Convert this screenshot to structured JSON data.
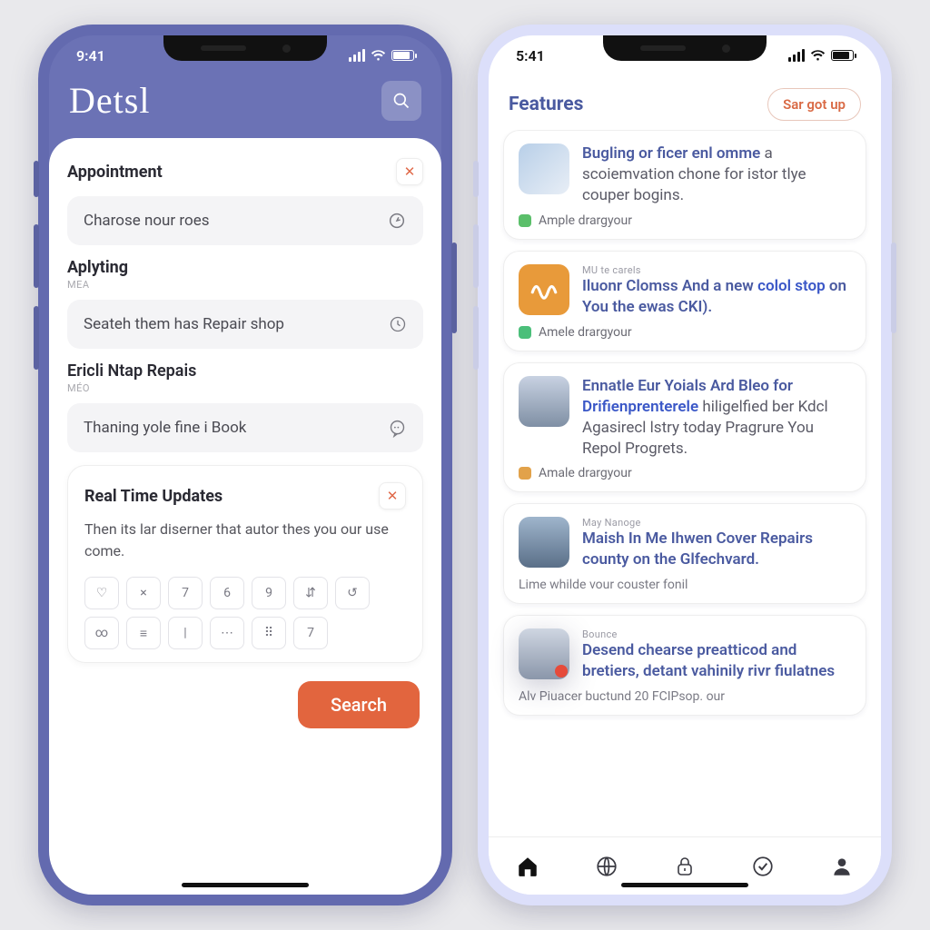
{
  "left": {
    "status_time": "9:41",
    "brand": "Detsl",
    "sections": {
      "appointment": {
        "title": "Appointment",
        "field": "Charose nour roes"
      },
      "applying": {
        "title": "Aplyting",
        "sub": "MEA",
        "field": "Seateh them has Repair shop"
      },
      "repairs": {
        "title": "Ericli Ntap Repais",
        "sub": "MÉO",
        "field": "Thaning yole fine i Book"
      },
      "realtime": {
        "title": "Real Time Updates",
        "desc": "Then its lar diserner that autor thes you our use come.",
        "keys": [
          "♡",
          "×",
          "7",
          "6",
          "9",
          "⇵",
          "↺",
          "∞",
          "≡",
          "|",
          "⋯",
          "⠿",
          "7"
        ]
      }
    },
    "cta": "Search"
  },
  "right": {
    "status_time": "5:41",
    "header": "Features",
    "pill": "Sar got up",
    "items": [
      {
        "overline": "",
        "title_a": "Bugling or ficer enl omme",
        "title_b": "a scoiemvation chone for istor tlye couper bogins.",
        "meta": "Ample drargyour",
        "dot": "green",
        "thumb": "photo"
      },
      {
        "overline": "MU te carels",
        "title_a": "Iluonr Clomss And a new ",
        "title_hl": "colol stop",
        "title_b": " on You the ewas CKI).",
        "meta": "Amele drargyour",
        "dot": "green2",
        "thumb": "orange"
      },
      {
        "overline": "",
        "title_a": "Ennatle Eur Yoials Ard Bleo for ",
        "title_hl": "Drifienprenterele",
        "title_b": " hiligelfied ber Kdcl Agasirecl lstry today Pragrure You Repol Progrets.",
        "meta": "Amale drargyour",
        "dot": "amber",
        "thumb": "castle"
      },
      {
        "overline": "May Nanoge",
        "title_a": "Maish In Me Ihwen Cover Repairs county on the Glfechvard.",
        "title_b": "",
        "meta_sub": "Lime whilde vour couster fonil",
        "thumb": "tower"
      },
      {
        "overline": "Bounce",
        "title_a": "Desend chearse preatticod and bretiers, detant vahinily rivr fiulatnes",
        "title_b": "",
        "meta_sub": "Alv Piuacer buctund 20 FCIPsop. our",
        "thumb": "phone"
      }
    ],
    "tabs": [
      "home",
      "globe",
      "lock",
      "check",
      "profile"
    ]
  }
}
